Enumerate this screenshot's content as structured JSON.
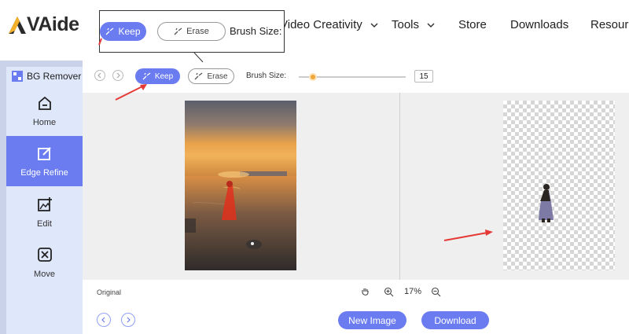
{
  "site": {
    "logo_text": "VAide",
    "nav": [
      {
        "label": "Video Creativity",
        "has_dropdown": true
      },
      {
        "label": "Tools",
        "has_dropdown": true
      },
      {
        "label": "Store",
        "has_dropdown": false
      },
      {
        "label": "Downloads",
        "has_dropdown": false
      },
      {
        "label": "Resource",
        "has_dropdown": false
      }
    ]
  },
  "overlay": {
    "keep_label": "Keep",
    "erase_label": "Erase",
    "brush_label": "Brush Size:"
  },
  "app": {
    "title": "BG Remover",
    "sidebar": [
      {
        "label": "Home",
        "icon": "home-icon",
        "active": false
      },
      {
        "label": "Edge Refine",
        "icon": "edit-square-icon",
        "active": true
      },
      {
        "label": "Edit",
        "icon": "image-edit-icon",
        "active": false
      },
      {
        "label": "Move",
        "icon": "move-icon",
        "active": false
      }
    ],
    "toolbar": {
      "keep_label": "Keep",
      "erase_label": "Erase",
      "brush_label": "Brush Size:",
      "brush_value": "15",
      "brush_fraction": 0.1
    },
    "status": {
      "original_label": "Original",
      "zoom_value": "17%"
    },
    "buttons": {
      "new_image": "New Image",
      "download": "Download"
    }
  },
  "colors": {
    "accent": "#6b7cf0",
    "sidebar_bg": "#dfe7fa",
    "arrow": "#e53935",
    "slider_thumb": "#f0a73a"
  }
}
